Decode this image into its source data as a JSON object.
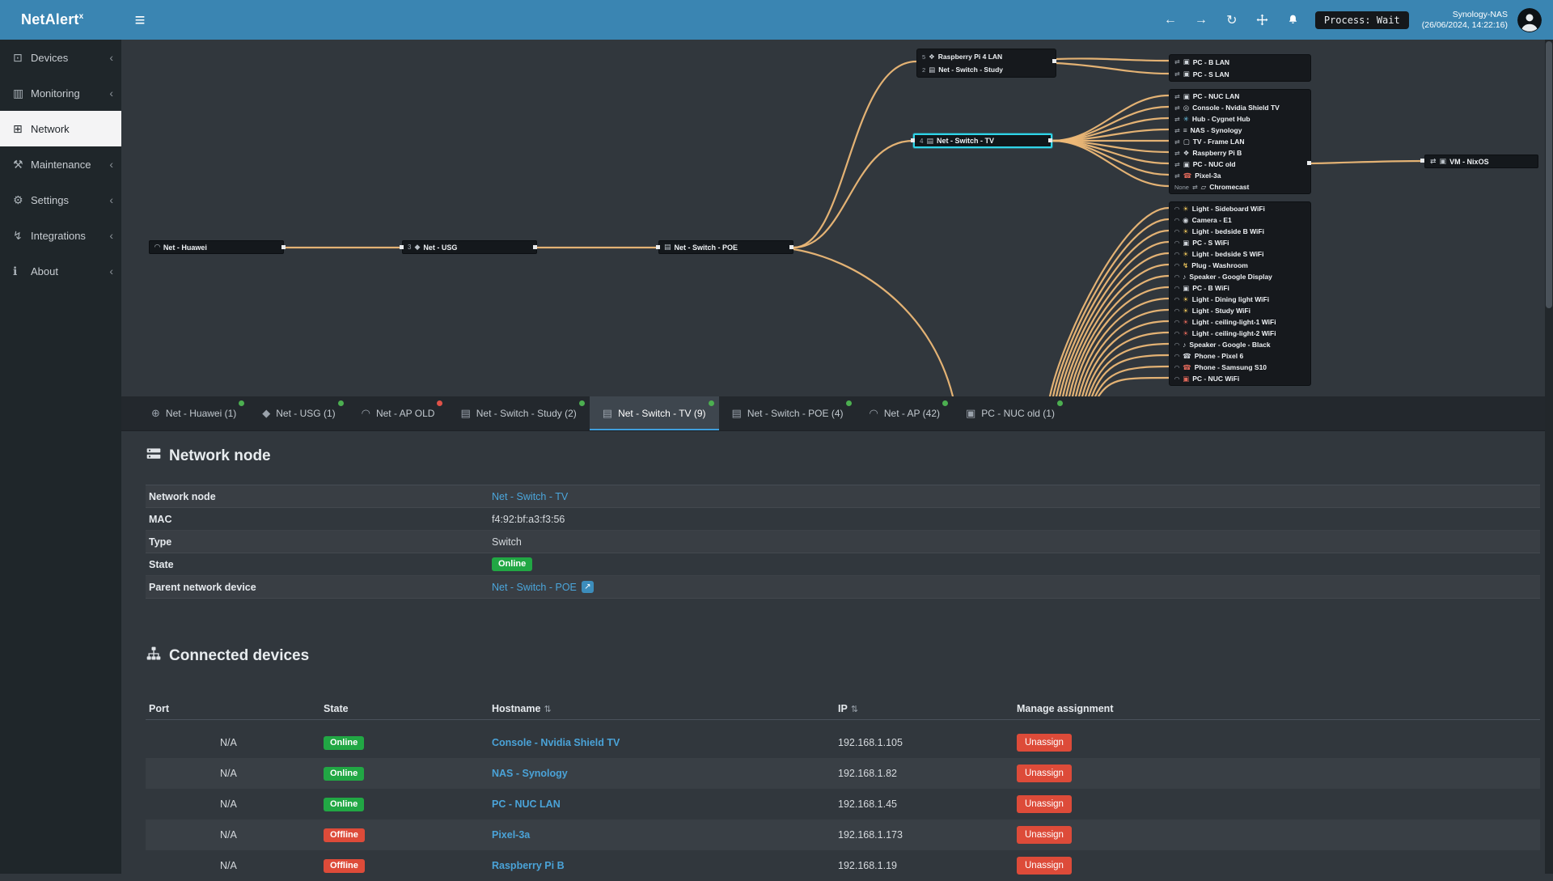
{
  "app": {
    "title": "NetAlert",
    "title_sup": "x"
  },
  "header": {
    "icons": {
      "menu": "≡",
      "back": "←",
      "forward": "→",
      "refresh": "↻"
    },
    "process_badge": "Process: Wait",
    "server_name": "Synology-NAS",
    "server_time": "(26/06/2024, 14:22:16)"
  },
  "sidebar": {
    "chevron": "‹",
    "items": [
      {
        "label": "Devices",
        "icon": "devices-icon",
        "glyph": "⊡"
      },
      {
        "label": "Monitoring",
        "icon": "monitoring-icon",
        "glyph": "▥"
      },
      {
        "label": "Network",
        "icon": "network-icon",
        "glyph": "⊞",
        "active": "true"
      },
      {
        "label": "Maintenance",
        "icon": "maintenance-icon",
        "glyph": "⚒"
      },
      {
        "label": "Settings",
        "icon": "settings-icon",
        "glyph": "⚙"
      },
      {
        "label": "Integrations",
        "icon": "integrations-icon",
        "glyph": "↯"
      },
      {
        "label": "About",
        "icon": "about-icon",
        "glyph": "ℹ"
      }
    ]
  },
  "diagram": {
    "huawei": {
      "name": "Net - Huawei",
      "glyph": "◠",
      "icon": "wifi-icon",
      "port": ""
    },
    "usg": {
      "name": "Net - USG",
      "glyph": "◆",
      "icon": "gateway-icon",
      "port": "3"
    },
    "poe": {
      "name": "Net - Switch - POE",
      "glyph": "▤",
      "icon": "switch-icon",
      "port": ""
    },
    "tv": {
      "name": "Net - Switch - TV",
      "glyph": "▤",
      "icon": "switch-icon",
      "port": "4"
    },
    "vm": {
      "name": "VM - NixOS",
      "glyph": "▣",
      "icon": "pc-icon",
      "port": "",
      "conn": "⇄"
    },
    "study_group": [
      {
        "port": "5",
        "glyph": "❖",
        "icon": "raspberry-icon",
        "name": "Raspberry Pi 4 LAN",
        "color": "#cfd4da"
      },
      {
        "port": "2",
        "glyph": "▤",
        "icon": "switch-icon",
        "name": "Net - Switch - Study",
        "color": "#cfd4da"
      }
    ],
    "lan_top_group": [
      {
        "conn": "⇄",
        "glyph": "▣",
        "icon": "pc-icon",
        "name": "PC - B LAN",
        "color": "#cfd4da"
      },
      {
        "conn": "⇄",
        "glyph": "▣",
        "icon": "pc-icon",
        "name": "PC - S LAN",
        "color": "#cfd4da"
      }
    ],
    "lan_group": [
      {
        "conn": "⇄",
        "glyph": "▣",
        "icon": "pc-icon",
        "name": "PC - NUC LAN",
        "color": "#cfd4da"
      },
      {
        "conn": "⇄",
        "glyph": "◎",
        "icon": "console-icon",
        "name": "Console - Nvidia Shield TV",
        "color": "#cfd4da"
      },
      {
        "conn": "⇄",
        "glyph": "✳",
        "icon": "hub-icon",
        "name": "Hub - Cygnet Hub",
        "color": "#6fc7ea"
      },
      {
        "conn": "⇄",
        "glyph": "≡",
        "icon": "nas-icon",
        "name": "NAS - Synology",
        "color": "#cfd4da"
      },
      {
        "conn": "⇄",
        "glyph": "▢",
        "icon": "tv-icon",
        "name": "TV - Frame LAN",
        "color": "#cfd4da"
      },
      {
        "conn": "⇄",
        "glyph": "❖",
        "icon": "raspberry-icon",
        "name": "Raspberry Pi B",
        "color": "#cfd4da"
      },
      {
        "conn": "⇄",
        "glyph": "▣",
        "icon": "pc-icon",
        "name": "PC - NUC old",
        "color": "#cfd4da"
      },
      {
        "conn": "⇄",
        "glyph": "☎",
        "icon": "phone-icon",
        "name": "Pixel-3a",
        "color": "#e0685a"
      },
      {
        "port": "None",
        "conn": "⇄",
        "glyph": "▱",
        "icon": "chromecast-icon",
        "name": "Chromecast",
        "color": "#cfd4da"
      }
    ],
    "wifi_group": [
      {
        "conn": "◠",
        "glyph": "☀",
        "icon": "light-icon",
        "name": "Light - Sideboard WiFi",
        "color": "#e8c15a"
      },
      {
        "conn": "◠",
        "glyph": "◉",
        "icon": "camera-icon",
        "name": "Camera - E1",
        "color": "#cfd4da"
      },
      {
        "conn": "◠",
        "glyph": "☀",
        "icon": "light-icon",
        "name": "Light - bedside B WiFi",
        "color": "#e8c15a"
      },
      {
        "conn": "◠",
        "glyph": "▣",
        "icon": "pc-icon",
        "name": "PC - S WiFi",
        "color": "#cfd4da"
      },
      {
        "conn": "◠",
        "glyph": "☀",
        "icon": "light-icon",
        "name": "Light - bedside S WiFi",
        "color": "#e8c15a"
      },
      {
        "conn": "◠",
        "glyph": "↯",
        "icon": "plug-icon",
        "name": "Plug - Washroom",
        "color": "#e8c15a"
      },
      {
        "conn": "◠",
        "glyph": "♪",
        "icon": "speaker-icon",
        "name": "Speaker - Google Display",
        "color": "#cfd4da"
      },
      {
        "conn": "◠",
        "glyph": "▣",
        "icon": "pc-icon",
        "name": "PC - B WiFi",
        "color": "#cfd4da"
      },
      {
        "conn": "◠",
        "glyph": "☀",
        "icon": "light-icon",
        "name": "Light - Dining light WiFi",
        "color": "#e8c15a"
      },
      {
        "conn": "◠",
        "glyph": "☀",
        "icon": "light-icon",
        "name": "Light - Study WiFi",
        "color": "#e8c15a"
      },
      {
        "conn": "◠",
        "glyph": "☀",
        "icon": "light-icon",
        "name": "Light - ceiling-light-1 WiFi",
        "color": "#e0685a"
      },
      {
        "conn": "◠",
        "glyph": "☀",
        "icon": "light-icon",
        "name": "Light - ceiling-light-2 WiFi",
        "color": "#e0685a"
      },
      {
        "conn": "◠",
        "glyph": "♪",
        "icon": "speaker-icon",
        "name": "Speaker - Google - Black",
        "color": "#cfd4da"
      },
      {
        "conn": "◠",
        "glyph": "☎",
        "icon": "phone-icon",
        "name": "Phone - Pixel 6",
        "color": "#cfd4da"
      },
      {
        "conn": "◠",
        "glyph": "☎",
        "icon": "phone-icon",
        "name": "Phone - Samsung S10",
        "color": "#e0685a"
      },
      {
        "conn": "◠",
        "glyph": "▣",
        "icon": "pc-icon",
        "name": "PC - NUC WiFi",
        "color": "#e0685a"
      }
    ]
  },
  "tabs": [
    {
      "label": "Net - Huawei (1)",
      "glyph": "⊕",
      "icon": "router-icon",
      "dot": "green"
    },
    {
      "label": "Net - USG (1)",
      "glyph": "◆",
      "icon": "gateway-icon",
      "dot": "green"
    },
    {
      "label": "Net - AP OLD",
      "glyph": "◠",
      "icon": "wifi-icon",
      "dot": "red"
    },
    {
      "label": "Net - Switch - Study (2)",
      "glyph": "▤",
      "icon": "switch-icon",
      "dot": "green"
    },
    {
      "label": "Net - Switch - TV (9)",
      "glyph": "▤",
      "icon": "switch-icon",
      "dot": "green",
      "active": "true"
    },
    {
      "label": "Net - Switch - POE (4)",
      "glyph": "▤",
      "icon": "switch-icon",
      "dot": "green"
    },
    {
      "label": "Net - AP (42)",
      "glyph": "◠",
      "icon": "wifi-icon",
      "dot": "green"
    },
    {
      "label": "PC - NUC old (1)",
      "glyph": "▣",
      "icon": "pc-icon",
      "dot": "green"
    }
  ],
  "network_node": {
    "section_title": "Network node",
    "fields": [
      {
        "label": "Network node",
        "link": "Net - Switch - TV"
      },
      {
        "label": "MAC",
        "text": "f4:92:bf:a3:f3:56"
      },
      {
        "label": "Type",
        "text": "Switch"
      },
      {
        "label": "State",
        "badge": "Online"
      },
      {
        "label": "Parent network device",
        "link": "Net - Switch - POE",
        "ext": "↗"
      }
    ]
  },
  "connected_devices": {
    "section_title": "Connected devices",
    "columns": {
      "port": "Port",
      "state": "State",
      "hostname": "Hostname",
      "ip": "IP",
      "manage": "Manage assignment"
    },
    "sort_glyph": "⇅",
    "unassign_label": "Unassign",
    "rows": [
      {
        "port": "N/A",
        "state": "Online",
        "hostname": "Console - Nvidia Shield TV",
        "ip": "192.168.1.105"
      },
      {
        "port": "N/A",
        "state": "Online",
        "hostname": "NAS - Synology",
        "ip": "192.168.1.82"
      },
      {
        "port": "N/A",
        "state": "Online",
        "hostname": "PC - NUC LAN",
        "ip": "192.168.1.45"
      },
      {
        "port": "N/A",
        "state": "Offline",
        "hostname": "Pixel-3a",
        "ip": "192.168.1.173"
      },
      {
        "port": "N/A",
        "state": "Offline",
        "hostname": "Raspberry Pi B",
        "ip": "192.168.1.19"
      }
    ]
  }
}
